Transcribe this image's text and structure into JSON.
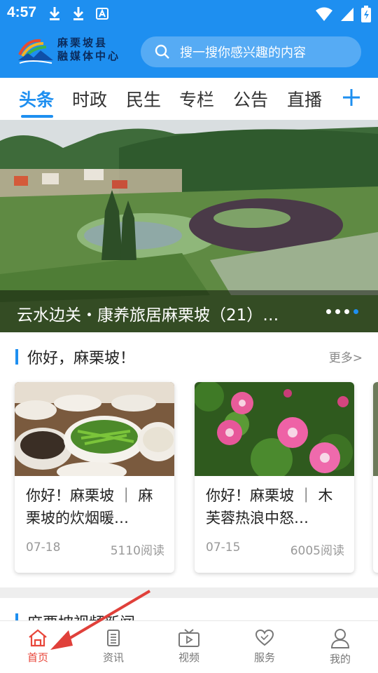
{
  "status_bar": {
    "time": "4:57",
    "icons": [
      "download-icon",
      "download-icon",
      "font-app-icon",
      "wifi-icon",
      "signal-icon",
      "battery-icon"
    ]
  },
  "header": {
    "logo_line1": "麻栗坡县",
    "logo_line2": "融媒体中心",
    "search_placeholder": "搜一搜你感兴趣的内容",
    "accent_color": "#1e8ff0"
  },
  "tabs": [
    {
      "label": "头条",
      "active": true
    },
    {
      "label": "时政"
    },
    {
      "label": "民生"
    },
    {
      "label": "专栏"
    },
    {
      "label": "公告"
    },
    {
      "label": "直播"
    }
  ],
  "banner": {
    "title": "云水边关・康养旅居麻栗坡（21）…",
    "slide_count": 4,
    "active_slide": 4
  },
  "section": {
    "title": "你好，麻栗坡！",
    "more": "更多>",
    "cards": [
      {
        "title": "你好！麻栗坡 ｜ 麻栗坡的炊烟暖…",
        "date": "07-18",
        "reads": "5110阅读",
        "image": "food-table-photo"
      },
      {
        "title": "你好！麻栗坡 ｜ 木芙蓉热浪中怒…",
        "date": "07-15",
        "reads": "6005阅读",
        "image": "hibiscus-flowers-photo"
      }
    ]
  },
  "section2": {
    "title": "麻栗坡视频新闻"
  },
  "bottom_nav": [
    {
      "label": "首页",
      "icon": "home-icon",
      "active": true
    },
    {
      "label": "资讯",
      "icon": "news-icon"
    },
    {
      "label": "视频",
      "icon": "tv-icon"
    },
    {
      "label": "服务",
      "icon": "heart-hands-icon"
    },
    {
      "label": "我的",
      "icon": "user-icon"
    }
  ],
  "colors": {
    "active_nav": "#e8463a",
    "arrow": "#e0403a"
  }
}
